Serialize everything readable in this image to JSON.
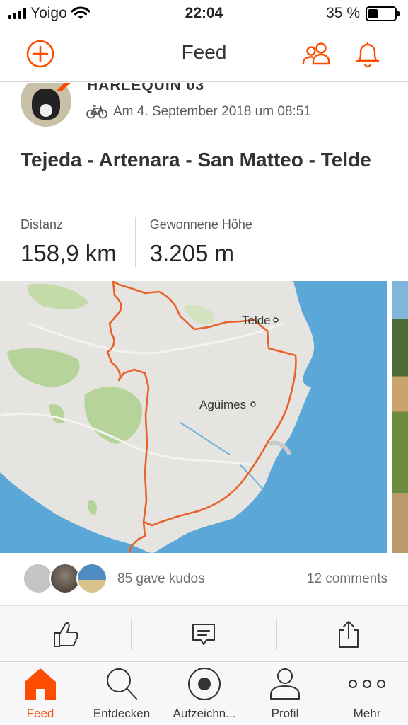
{
  "status_bar": {
    "carrier": "Yoigo",
    "time": "22:04",
    "battery_percent": "35 %",
    "battery_level": 0.35
  },
  "nav": {
    "title": "Feed"
  },
  "activity": {
    "athlete_name": "HARLEQUIN 03",
    "date": "Am 4. September 2018 um 08:51",
    "sport_icon": "bike-icon",
    "title": "Tejeda - Artenara - San Matteo - Telde",
    "stats": [
      {
        "label": "Distanz",
        "value": "158,9 km"
      },
      {
        "label": "Gewonnene Höhe",
        "value": "3.205 m"
      }
    ],
    "map_labels": {
      "town_1": "Telde",
      "town_2": "Agüimes"
    },
    "kudos_text": "85 gave kudos",
    "comments_text": "12 comments"
  },
  "colors": {
    "accent": "#fc4c02",
    "route": "#e8622b",
    "sea": "#5aa7d8",
    "land": "#e6e4e0",
    "green": "#b6d49a"
  },
  "actions": [
    "thumbs-up-icon",
    "comment-icon",
    "share-icon"
  ],
  "tabs": [
    {
      "label": "Feed",
      "icon": "home-icon",
      "active": true
    },
    {
      "label": "Entdecken",
      "icon": "search-icon",
      "active": false
    },
    {
      "label": "Aufzeichn...",
      "icon": "record-icon",
      "active": false
    },
    {
      "label": "Profil",
      "icon": "profile-icon",
      "active": false
    },
    {
      "label": "Mehr",
      "icon": "more-icon",
      "active": false
    }
  ]
}
